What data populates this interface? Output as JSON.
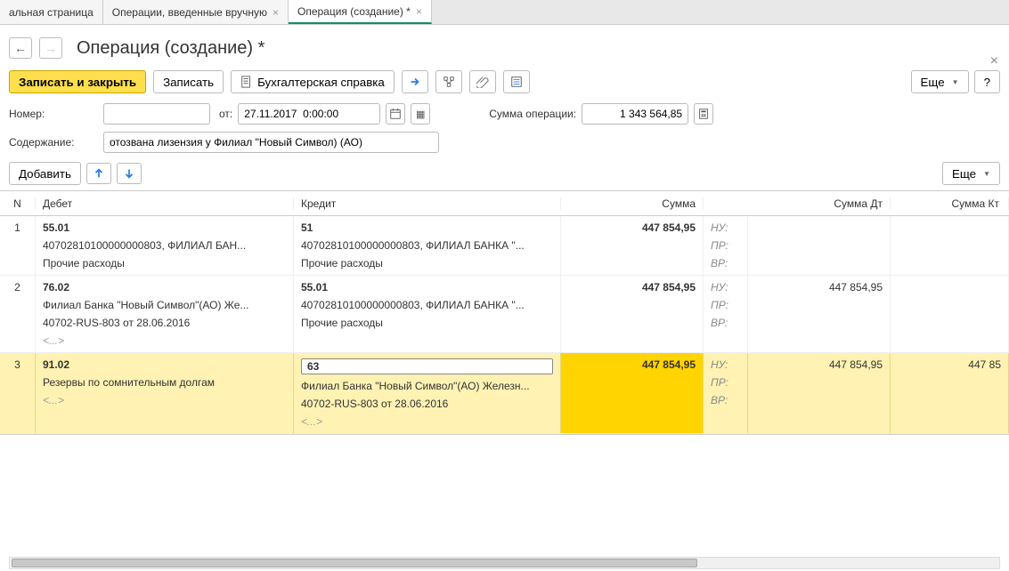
{
  "tabs": [
    {
      "label": "альная страница",
      "closable": false
    },
    {
      "label": "Операции, введенные вручную",
      "closable": true
    },
    {
      "label": "Операция (создание) *",
      "closable": true,
      "active": true
    }
  ],
  "page_title": "Операция (создание) *",
  "toolbar": {
    "save_close": "Записать и закрыть",
    "save": "Записать",
    "accounting_note": "Бухгалтерская справка",
    "more": "Еще",
    "help": "?"
  },
  "form": {
    "number_label": "Номер:",
    "number_value": "",
    "from_label": "от:",
    "date_value": "27.11.2017  0:00:00",
    "sum_label": "Сумма операции:",
    "sum_value": "1 343 564,85",
    "content_label": "Содержание:",
    "content_value": "отозвана лизензия у Филиал \"Новый Символ) (АО)"
  },
  "table_toolbar": {
    "add": "Добавить",
    "more": "Еще"
  },
  "grid": {
    "headers": {
      "n": "N",
      "debit": "Дебет",
      "credit": "Кредит",
      "sum": "Сумма",
      "sum_dt": "Сумма Дт",
      "sum_kt": "Сумма Кт"
    },
    "tax_labels": {
      "nu": "НУ:",
      "pr": "ПР:",
      "vr": "ВР:"
    },
    "rows": [
      {
        "n": "1",
        "debit": {
          "account": "55.01",
          "line2": "40702810100000000803, ФИЛИАЛ БАН...",
          "line3": "Прочие расходы"
        },
        "credit": {
          "account": "51",
          "line2": "40702810100000000803, ФИЛИАЛ БАНКА \"...",
          "line3": "Прочие расходы"
        },
        "sum": "447 854,95",
        "sum_dt": "",
        "sum_kt": "",
        "selected": false
      },
      {
        "n": "2",
        "debit": {
          "account": "76.02",
          "line2": "Филиал Банка \"Новый Символ\"(АО) Же...",
          "line3": "40702-RUS-803 от 28.06.2016",
          "line4": "<...>"
        },
        "credit": {
          "account": "55.01",
          "line2": "40702810100000000803, ФИЛИАЛ БАНКА \"...",
          "line3": "Прочие расходы"
        },
        "sum": "447 854,95",
        "sum_dt": "447 854,95",
        "sum_kt": "",
        "selected": false
      },
      {
        "n": "3",
        "debit": {
          "account": "91.02",
          "line2": "Резервы по сомнительным долгам",
          "line3": "<...>"
        },
        "credit": {
          "account": "63",
          "line2": "Филиал Банка \"Новый Символ\"(АО) Железн...",
          "line3": "40702-RUS-803 от 28.06.2016",
          "line4": "<...>"
        },
        "sum": "447 854,95",
        "sum_dt": "447 854,95",
        "sum_kt": "447 85",
        "selected": true
      }
    ]
  }
}
